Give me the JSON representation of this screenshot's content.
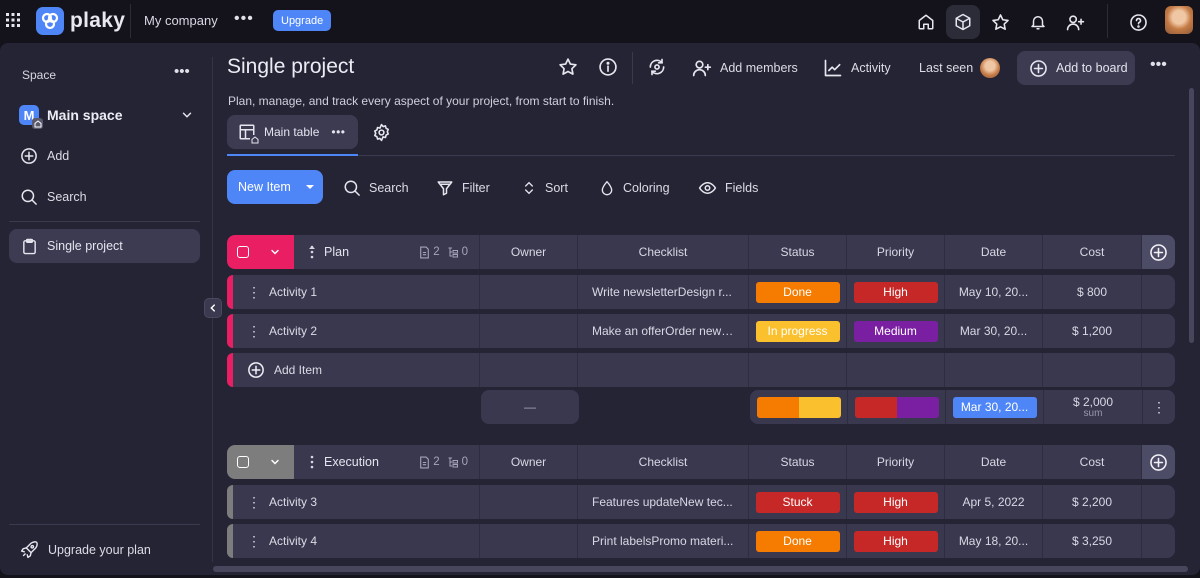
{
  "topbar": {
    "brand": "plaky",
    "company": "My company",
    "more_label": "•••",
    "upgrade_label": "Upgrade",
    "icons": [
      "home-icon",
      "boards-cube-icon",
      "star-icon",
      "bell-icon",
      "invite-user-icon",
      "help-icon"
    ]
  },
  "sidebar": {
    "section_label": "Space",
    "more_label": "•••",
    "space_initial": "M",
    "space_name": "Main space",
    "add_label": "Add",
    "search_label": "Search",
    "active_project": "Single project",
    "upgrade_plan_label": "Upgrade your plan"
  },
  "header": {
    "title": "Single project",
    "description": "Plan, manage, and track every aspect of your project, from start to finish.",
    "add_members_label": "Add members",
    "activity_label": "Activity",
    "last_seen_label": "Last seen",
    "add_to_board_label": "Add to board",
    "more_label": "•••"
  },
  "views": {
    "active_view": "Main table",
    "view_more": "•••"
  },
  "toolbar": {
    "new_item_label": "New Item",
    "search_label": "Search",
    "filter_label": "Filter",
    "sort_label": "Sort",
    "coloring_label": "Coloring",
    "fields_label": "Fields"
  },
  "columns": {
    "owner": "Owner",
    "checklist": "Checklist",
    "status": "Status",
    "priority": "Priority",
    "date": "Date",
    "cost": "Cost"
  },
  "colors": {
    "accent": "#4f86f7",
    "plan_group": "#e91e63",
    "execution_group": "#7d7d7d",
    "done": "#f57c00",
    "in_progress": "#fbc02d",
    "stuck": "#c62828",
    "high": "#c62828",
    "medium": "#7b1fa2"
  },
  "groups": [
    {
      "name": "Plan",
      "item_count": "2",
      "subitem_count": "0",
      "items": [
        {
          "name": "Activity 1",
          "checklist": "Write newsletterDesign r...",
          "status": "Done",
          "status_color": "#f57c00",
          "priority": "High",
          "priority_color": "#c62828",
          "date": "May 10, 20...",
          "cost": "$ 800"
        },
        {
          "name": "Activity 2",
          "checklist": "Make an offerOrder new ...",
          "status": "In progress",
          "status_color": "#fbc02d",
          "priority": "Medium",
          "priority_color": "#7b1fa2",
          "date": "Mar 30, 20...",
          "cost": "$ 1,200"
        }
      ],
      "add_item_label": "Add Item",
      "summary": {
        "owner": "—",
        "status_distribution": [
          {
            "color": "#f57c00",
            "share": 0.5
          },
          {
            "color": "#fbc02d",
            "share": 0.5
          }
        ],
        "priority_distribution": [
          {
            "color": "#c62828",
            "share": 0.5
          },
          {
            "color": "#7b1fa2",
            "share": 0.5
          }
        ],
        "date": "Mar 30, 20...",
        "cost": "$ 2,000",
        "cost_caption": "sum"
      }
    },
    {
      "name": "Execution",
      "item_count": "2",
      "subitem_count": "0",
      "items": [
        {
          "name": "Activity 3",
          "checklist": "Features updateNew tec...",
          "status": "Stuck",
          "status_color": "#c62828",
          "priority": "High",
          "priority_color": "#c62828",
          "date": "Apr 5, 2022",
          "cost": "$ 2,200"
        },
        {
          "name": "Activity 4",
          "checklist": "Print labelsPromo materi...",
          "status": "Done",
          "status_color": "#f57c00",
          "priority": "High",
          "priority_color": "#c62828",
          "date": "May 18, 20...",
          "cost": "$ 3,250"
        }
      ]
    }
  ]
}
